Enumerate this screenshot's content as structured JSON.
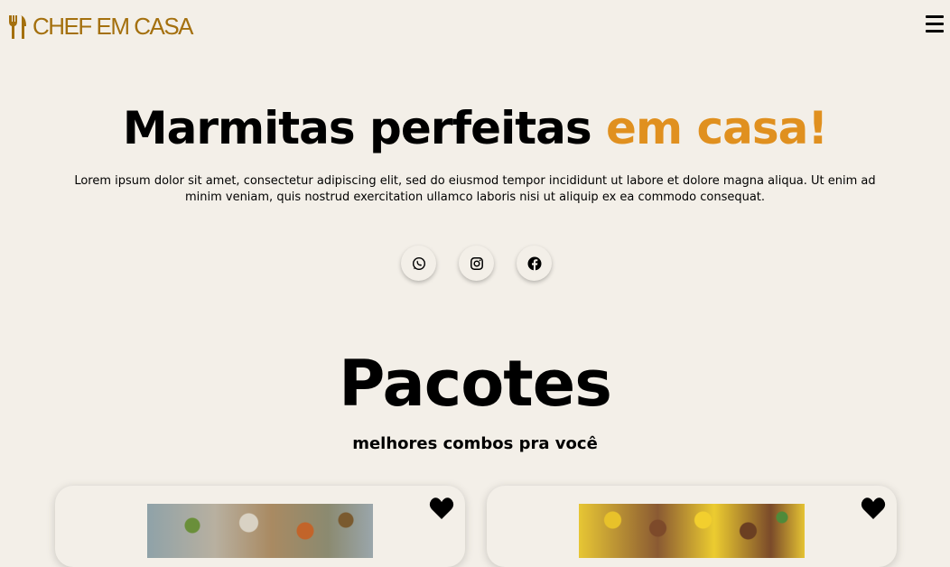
{
  "header": {
    "logo_text": "CHEF EM CASA",
    "logo_icon": "fork-knife-icon",
    "menu_icon": "hamburger-menu-icon"
  },
  "hero": {
    "title_main": "Marmitas perfeitas",
    "title_accent": "em casa!",
    "description": "Lorem ipsum dolor sit amet, consectetur adipiscing elit, sed do eiusmod tempor incididunt ut labore et dolore magna aliqua. Ut enim ad minim veniam, quis nostrud exercitation ullamco laboris nisi ut aliquip ex ea commodo consequat."
  },
  "socials": [
    "whatsapp-icon",
    "instagram-icon",
    "facebook-icon"
  ],
  "packages": {
    "title": "Pacotes",
    "subtitle": "melhores combos pra você",
    "cards": [
      {
        "image": "marmitas-food-image-1",
        "favorite_icon": "heart-icon"
      },
      {
        "image": "marmitas-food-image-2",
        "favorite_icon": "heart-icon"
      }
    ]
  },
  "colors": {
    "background": "#f3efe8",
    "accent": "#e0901f",
    "logo": "#a4700e"
  }
}
